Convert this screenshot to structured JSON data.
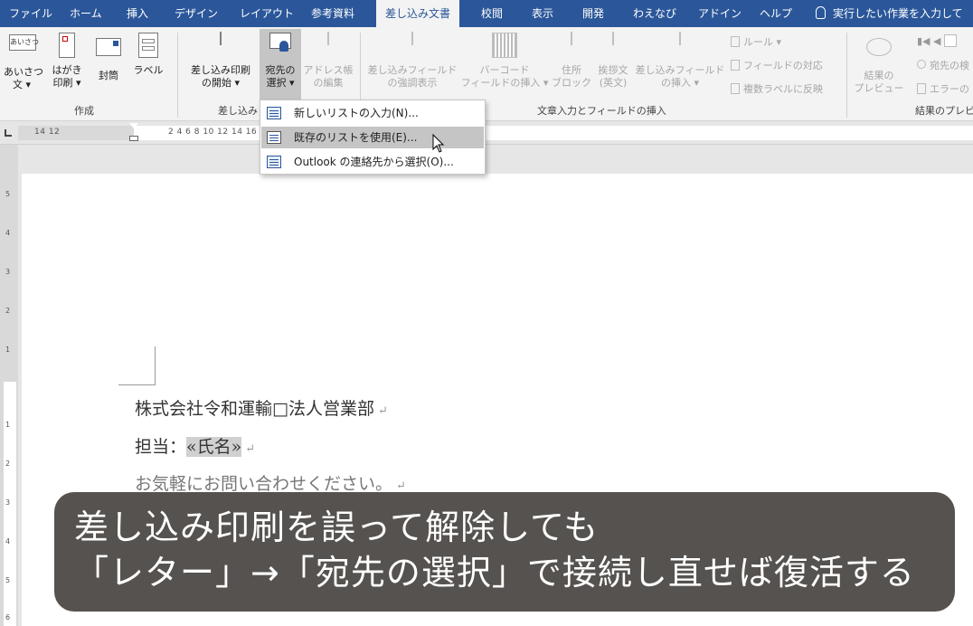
{
  "tabs": [
    {
      "label": "ファイル",
      "active": false
    },
    {
      "label": "ホーム",
      "active": false
    },
    {
      "label": "挿入",
      "active": false
    },
    {
      "label": "デザイン",
      "active": false
    },
    {
      "label": "レイアウト",
      "active": false
    },
    {
      "label": "参考資料",
      "active": false
    },
    {
      "label": "差し込み文書",
      "active": true
    },
    {
      "label": "校閲",
      "active": false
    },
    {
      "label": "表示",
      "active": false
    },
    {
      "label": "開発",
      "active": false
    },
    {
      "label": "わえなび",
      "active": false
    },
    {
      "label": "アドイン",
      "active": false
    },
    {
      "label": "ヘルプ",
      "active": false
    }
  ],
  "tellme": "実行したい作業を入力して",
  "ribbon": {
    "create_group": {
      "label": "作成",
      "greeting": {
        "line1": "あいさつ",
        "line2": "文 ▾",
        "icon_text": "あいさつ"
      },
      "postcard": {
        "line1": "はがき",
        "line2": "印刷 ▾"
      },
      "envelope": {
        "line1": "封筒"
      },
      "label_btn": {
        "line1": "ラベル"
      }
    },
    "start_group": {
      "label": "差し込み",
      "start_merge": {
        "line1": "差し込み印刷",
        "line2": "の開始 ▾"
      },
      "select_recipients": {
        "line1": "宛先の",
        "line2": "選択 ▾"
      },
      "edit_list": {
        "line1": "アドレス帳",
        "line2": "の編集"
      }
    },
    "fields_group": {
      "label": "文章入力とフィールドの挿入",
      "highlight": {
        "line1": "差し込みフィールド",
        "line2": "の強調表示"
      },
      "barcode": {
        "line1": "バーコード",
        "line2": "フィールドの挿入 ▾"
      },
      "address": {
        "line1": "住所",
        "line2": "ブロック"
      },
      "greeting_line": {
        "line1": "挨拶文",
        "line2": "(英文)"
      },
      "insert_field": {
        "line1": "差し込みフィールド",
        "line2": "の挿入 ▾"
      },
      "rules": "ルール ▾",
      "match_fields": "フィールドの対応",
      "update_labels": "複数ラベルに反映"
    },
    "preview_group": {
      "label": "結果のプレビ",
      "preview": {
        "line1": "結果の",
        "line2": "プレビュー"
      },
      "find_recipient": "宛先の検",
      "check_errors": "エラーの"
    }
  },
  "ruler": {
    "left_text": "14   12",
    "right_text": "2    4    6    8   10   12   14   16   18   20   22   24   26   28   30   32   34   36"
  },
  "vruler_numbers": [
    "5",
    "4",
    "3",
    "2",
    "1",
    "1",
    "2",
    "3",
    "4",
    "5",
    "6"
  ],
  "dropdown": {
    "items": [
      {
        "label": "新しいリストの入力(N)...",
        "hover": false
      },
      {
        "label": "既存のリストを使用(E)...",
        "hover": true
      },
      {
        "label": "Outlook の連絡先から選択(O)...",
        "hover": false
      }
    ]
  },
  "document": {
    "line1": "株式会社令和運輸□法人営業部",
    "line2_prefix": "担当：",
    "line2_field": "«氏名»",
    "line3": "お気軽にお問い合わせください。",
    "para_mark": "↵"
  },
  "caption": {
    "line1": "差し込み印刷を誤って解除しても",
    "line2": "「レター」→「宛先の選択」で接続し直せば復活する"
  },
  "colors": {
    "tab_bar": "#2b579a",
    "ribbon_bg": "#f3f3f3",
    "caption_bg": "#484340",
    "menu_hover": "#c5c5c5"
  }
}
